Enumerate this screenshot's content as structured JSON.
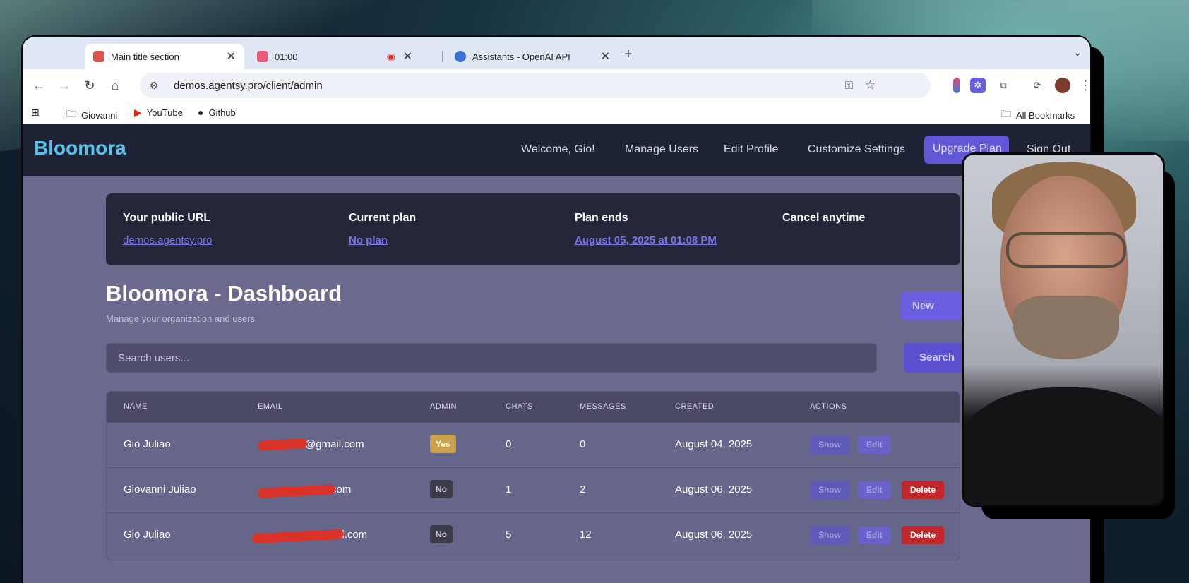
{
  "browser": {
    "tabs": [
      {
        "label": "Main title section",
        "active": true
      },
      {
        "label": "01:00",
        "active": false
      },
      {
        "label": "Assistants - OpenAI API",
        "active": false
      }
    ],
    "url": "demos.agentsy.pro/client/admin",
    "bookmarks": [
      "Giovanni",
      "YouTube",
      "Github"
    ],
    "all_bookmarks": "All Bookmarks"
  },
  "app": {
    "brand": "Bloomora",
    "nav": {
      "welcome": "Welcome, Gio!",
      "manage_users": "Manage Users",
      "edit_profile": "Edit Profile",
      "customize_settings": "Customize Settings",
      "upgrade": "Upgrade Plan",
      "sign_out": "Sign Out"
    },
    "info": {
      "public_url_label": "Your public URL",
      "public_url": "demos.agentsy.pro",
      "plan_label": "Current plan",
      "plan": "No plan",
      "plan_ends_label": "Plan ends",
      "plan_ends": "August 05, 2025 at 01:08 PM",
      "cancel_label": "Cancel anytime"
    },
    "dashboard": {
      "title": "Bloomora - Dashboard",
      "subtitle": "Manage your organization and users",
      "new_button": "New",
      "search_placeholder": "Search users...",
      "search_button": "Search"
    },
    "table": {
      "headers": [
        "NAME",
        "EMAIL",
        "ADMIN",
        "CHATS",
        "MESSAGES",
        "CREATED",
        "ACTIONS"
      ],
      "rows": [
        {
          "name": "Gio Juliao",
          "email": "@gmail.com",
          "admin": "Yes",
          "chats": "0",
          "messages": "0",
          "created": "August 04, 2025",
          "show": "Show",
          "edit": "Edit"
        },
        {
          "name": "Giovanni Juliao",
          "email": "com",
          "admin": "No",
          "chats": "1",
          "messages": "2",
          "created": "August 06, 2025",
          "show": "Show",
          "edit": "Edit",
          "delete": "Delete"
        },
        {
          "name": "Gio Juliao",
          "email": "il.com",
          "admin": "No",
          "chats": "5",
          "messages": "12",
          "created": "August 06, 2025",
          "show": "Show",
          "edit": "Edit",
          "delete": "Delete"
        }
      ]
    }
  },
  "colors": {
    "nav_bg": "#1e2235",
    "brand": "#5bc0ea",
    "accent": "#6157d6",
    "delete": "#c0272d",
    "badge_yes": "#c9a24b"
  }
}
